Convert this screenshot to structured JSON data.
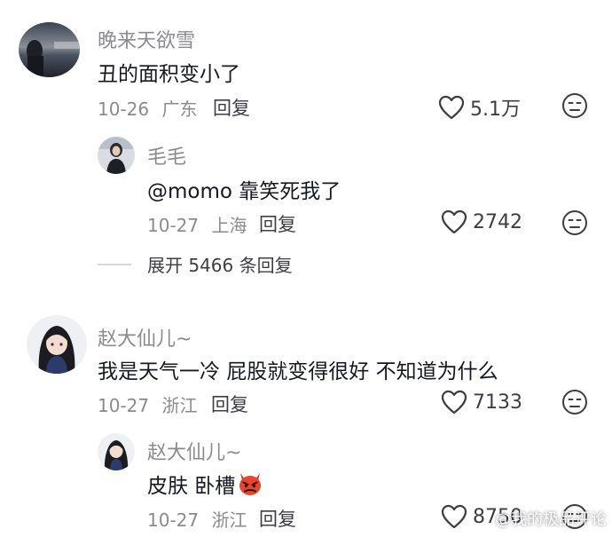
{
  "comments": [
    {
      "username": "晚来天欲雪",
      "text": "丑的面积变小了",
      "date": "10-26",
      "location": "广东",
      "reply_label": "回复",
      "likes": "5.1万"
    },
    {
      "username": "毛毛",
      "text": "@momo 靠笑死我了",
      "date": "10-27",
      "location": "上海",
      "reply_label": "回复",
      "likes": "2742"
    },
    {
      "username": "赵大仙儿~",
      "text": "我是天气一冷 屁股就变得很好 不知道为什么",
      "date": "10-27",
      "location": "浙江",
      "reply_label": "回复",
      "likes": "7133"
    },
    {
      "username": "赵大仙儿~",
      "text": "皮肤 卧槽",
      "date": "10-27",
      "location": "浙江",
      "reply_label": "回复",
      "likes": "8750"
    }
  ],
  "expand_replies": "展开 5466 条回复",
  "watermark": "@我的极品评论",
  "icons": {
    "like": "heart-icon",
    "dislike": "dislike-face-icon",
    "emoji": "angry-devil-emoji"
  },
  "colors": {
    "meta": "#8a8b91",
    "text": "#161823",
    "icon": "#3d3e45"
  }
}
